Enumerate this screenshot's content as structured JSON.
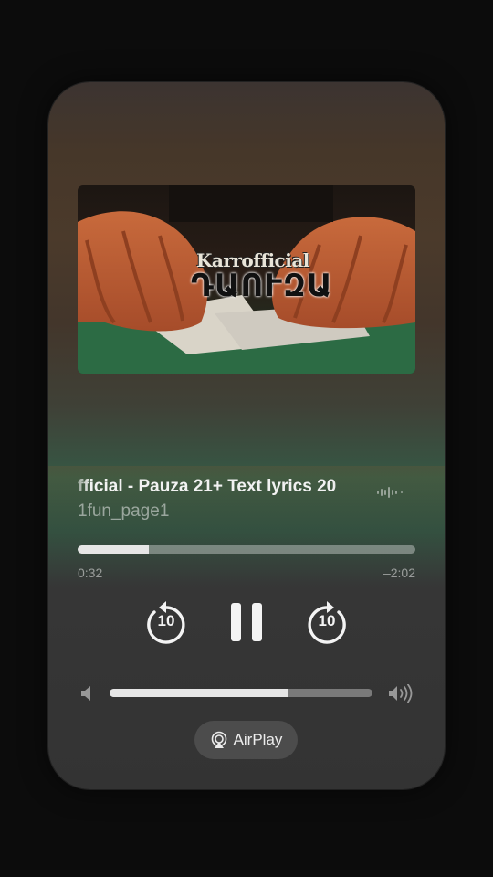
{
  "player": {
    "title": "fficial - Pauza 21+ Text lyrics 20",
    "artist": "1fun_page1",
    "elapsed": "0:32",
    "remaining": "–2:02",
    "progress_fraction": 0.21,
    "volume_fraction": 0.68,
    "skip_back_seconds": "10",
    "skip_forward_seconds": "10",
    "airplay_label": "AirPlay"
  },
  "artwork": {
    "logo_top": "Karrofficial",
    "logo_bottom": "ԴԱՈՒԶԱ"
  },
  "icons": {
    "skip_back": "gobackward-10-icon",
    "pause": "pause-icon",
    "skip_forward": "goforward-10-icon",
    "volume_low": "speaker-icon",
    "volume_high": "speaker-wave-icon",
    "airplay": "airplay-icon",
    "waveform": "waveform-icon"
  }
}
